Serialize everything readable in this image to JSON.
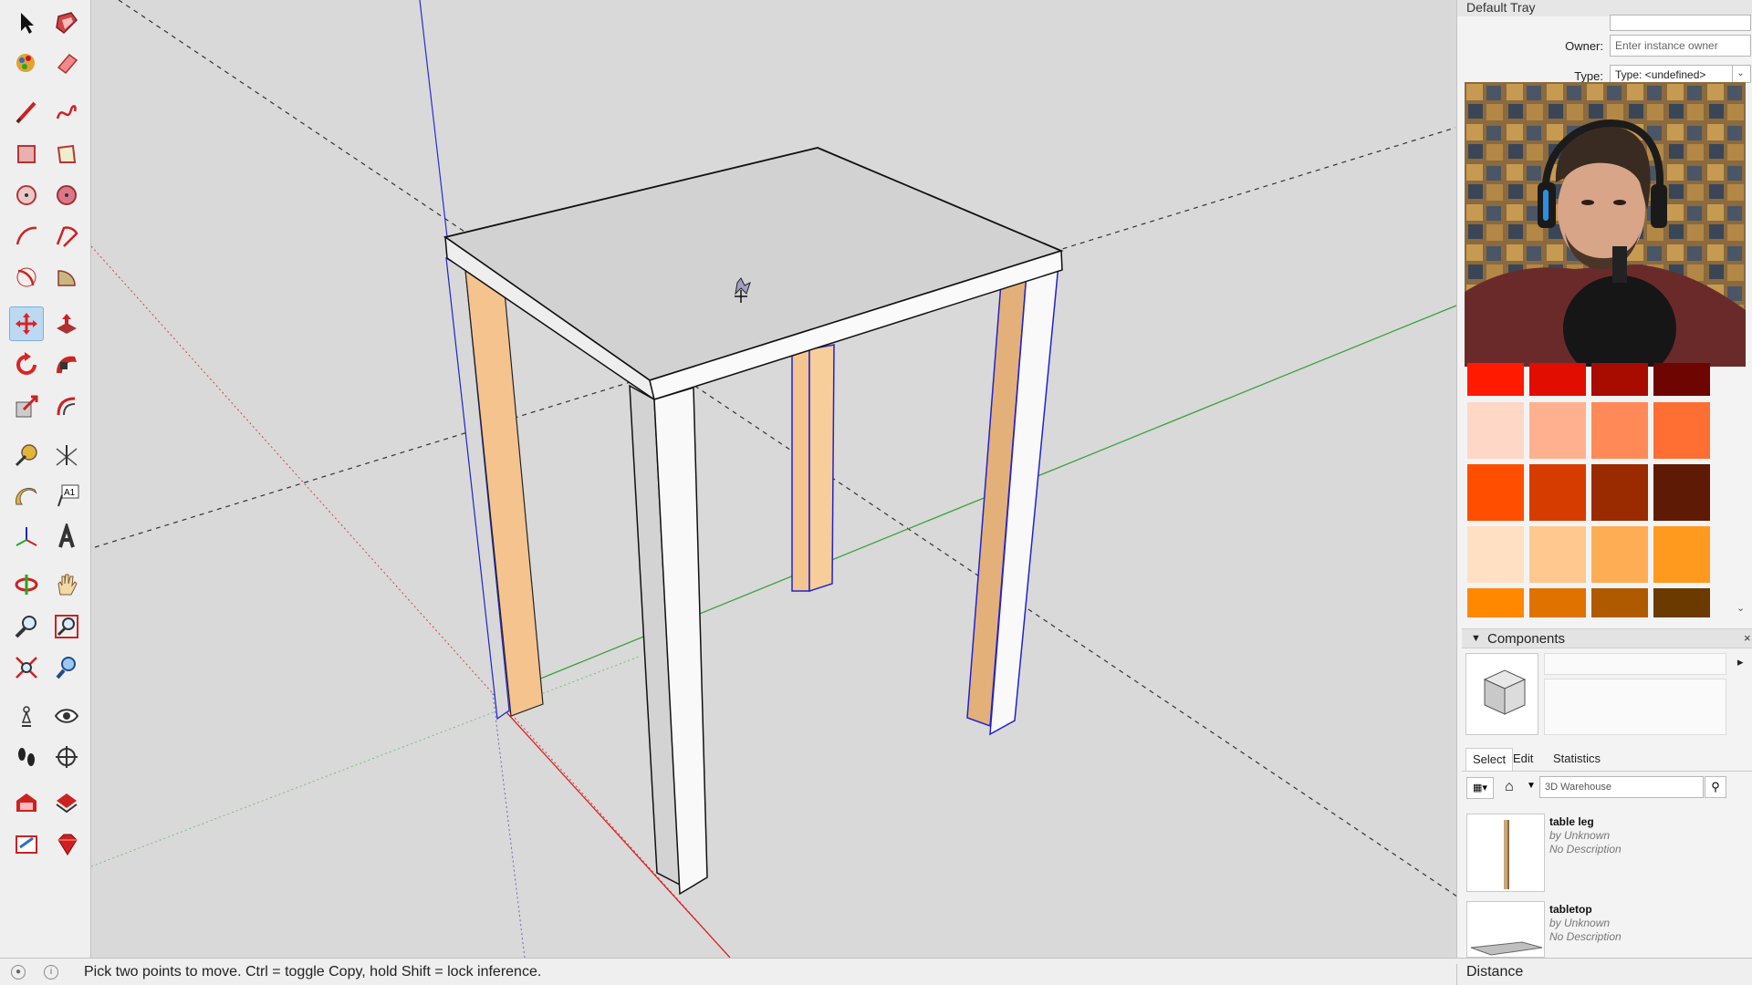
{
  "tray": {
    "title": "Default Tray",
    "entity_info": {
      "owner_label": "Owner:",
      "owner_placeholder": "Enter instance owner",
      "type_label": "Type:",
      "type_value": "Type: <undefined>"
    },
    "colors": {
      "swatches": [
        "#ff1a00",
        "#e00d00",
        "#a80b00",
        "#6e0500",
        "#ffd7c6",
        "#ffb08f",
        "#ff8a58",
        "#ff6e33",
        "#ff4e00",
        "#d63c00",
        "#9a2a00",
        "#5e1a05",
        "#ffe0c2",
        "#ffc88e",
        "#ffad55",
        "#ff9a1e",
        "#ff8800",
        "#e07200",
        "#b05a00",
        "#6a3a00"
      ]
    },
    "components": {
      "header": "Components",
      "tabs": [
        "Select",
        "Edit",
        "Statistics"
      ],
      "search_placeholder": "3D Warehouse",
      "items": [
        {
          "name": "table leg",
          "by": "by Unknown",
          "desc": "No Description"
        },
        {
          "name": "tabletop",
          "by": "by Unknown",
          "desc": "No Description"
        }
      ]
    }
  },
  "statusbar": {
    "message": "Pick two points to move.  Ctrl = toggle Copy, hold Shift = lock inference.",
    "measure_label": "Distance"
  },
  "toolbar": {
    "active_tool": "move-tool"
  }
}
